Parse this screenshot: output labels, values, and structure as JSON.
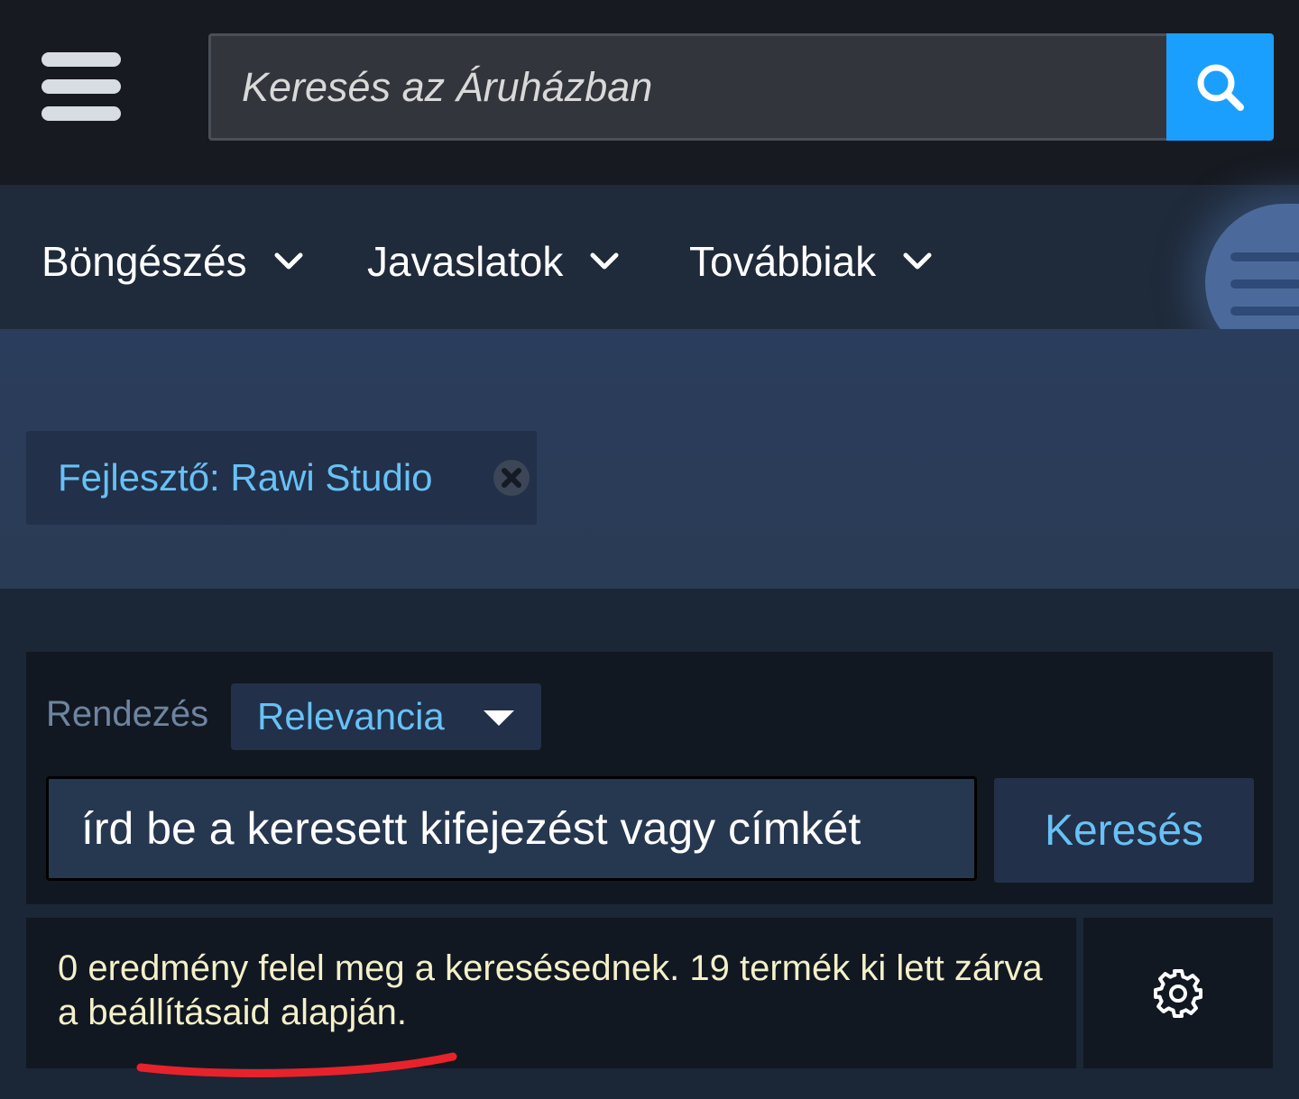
{
  "header": {
    "search_placeholder": "Keresés az Áruházban",
    "search_button_icon": "search-icon",
    "menu_icon": "hamburger-menu-icon"
  },
  "nav": {
    "items": [
      {
        "label": "Böngészés",
        "icon": "chevron-down-icon"
      },
      {
        "label": "Javaslatok",
        "icon": "chevron-down-icon"
      },
      {
        "label": "Továbbiak",
        "icon": "chevron-down-icon"
      }
    ],
    "side_menu_icon": "list-menu-icon"
  },
  "filter": {
    "chip_label": "Fejlesztő: Rawi Studio",
    "remove_icon": "close-circle-icon"
  },
  "sort": {
    "label": "Rendezés",
    "selected": "Relevancia"
  },
  "term_search": {
    "placeholder": "írd be a keresett kifejezést vagy címkét",
    "button_label": "Keresés"
  },
  "results": {
    "summary": "0 eredmény felel meg a keresésednek. 19 termék ki lett zárva a beállításaid alapján.",
    "settings_icon": "gear-icon"
  },
  "colors": {
    "accent": "#1a9fff",
    "link": "#67c1f5",
    "result_text": "#f4f0c8",
    "annotation": "#e8222b"
  }
}
